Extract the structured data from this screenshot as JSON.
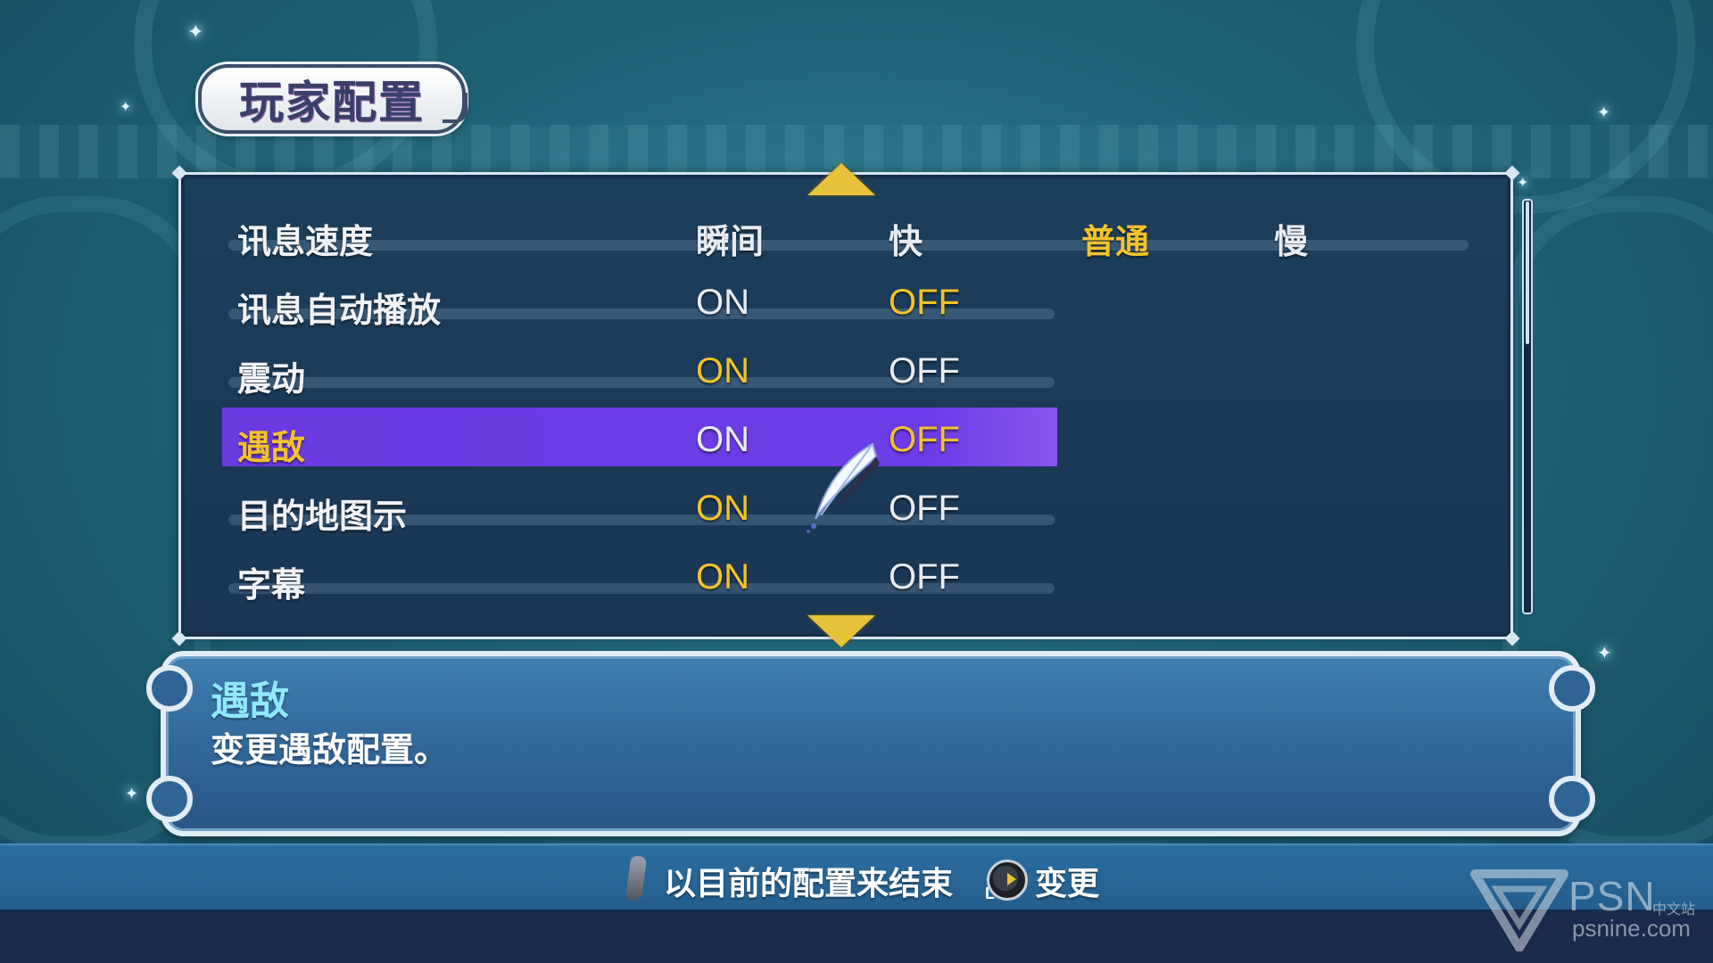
{
  "screen": {
    "title": "玩家配置"
  },
  "options": [
    {
      "label": "讯息速度",
      "values": [
        "瞬间",
        "快",
        "普通",
        "慢"
      ],
      "selected_index": 2
    },
    {
      "label": "讯息自动播放",
      "values": [
        "ON",
        "OFF"
      ],
      "selected_index": 1
    },
    {
      "label": "震动",
      "values": [
        "ON",
        "OFF"
      ],
      "selected_index": 0
    },
    {
      "label": "遇敌",
      "values": [
        "ON",
        "OFF"
      ],
      "selected_index": 1,
      "focused": true
    },
    {
      "label": "目的地图示",
      "values": [
        "ON",
        "OFF"
      ],
      "selected_index": 0
    },
    {
      "label": "字幕",
      "values": [
        "ON",
        "OFF"
      ],
      "selected_index": 0
    }
  ],
  "description": {
    "title": "遇敌",
    "text": "变更遇敌配置。"
  },
  "hints": {
    "exit_label": "以目前的配置来结束",
    "change_label": "变更",
    "exit_icon": "controller-stick-icon",
    "change_icon": "left-stick-icon",
    "change_icon_letter": "L"
  },
  "watermark": {
    "brand": "PSN",
    "brand_sub": "中文站",
    "url": "psnine.com"
  },
  "colors": {
    "selected_value": "#f3c22c",
    "highlight_row": "#6c3ce6",
    "description_title": "#8fe9ff",
    "arrow": "#e7c23a"
  }
}
